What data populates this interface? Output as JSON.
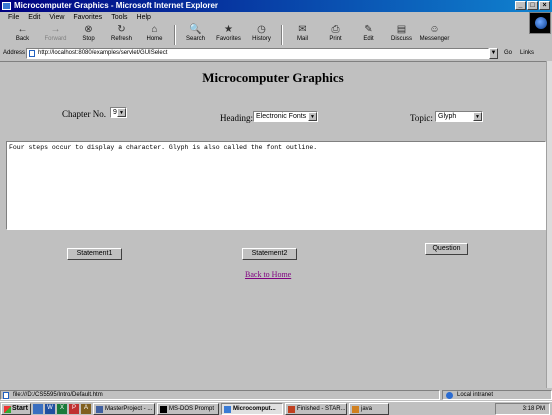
{
  "window": {
    "title": "Microcomputer Graphics - Microsoft Internet Explorer"
  },
  "menu": [
    "File",
    "Edit",
    "View",
    "Favorites",
    "Tools",
    "Help"
  ],
  "toolbar": [
    {
      "label": "Back",
      "icon": "←"
    },
    {
      "label": "Forward",
      "icon": "→"
    },
    {
      "label": "Stop",
      "icon": "⊗"
    },
    {
      "label": "Refresh",
      "icon": "↻"
    },
    {
      "label": "Home",
      "icon": "⌂"
    },
    {
      "label": "Search",
      "icon": "🔍"
    },
    {
      "label": "Favorites",
      "icon": "★"
    },
    {
      "label": "History",
      "icon": "◷"
    },
    {
      "label": "Mail",
      "icon": "✉"
    },
    {
      "label": "Print",
      "icon": "⎙"
    },
    {
      "label": "Edit",
      "icon": "✎"
    },
    {
      "label": "Discuss",
      "icon": "▤"
    },
    {
      "label": "Messenger",
      "icon": "☺"
    }
  ],
  "address": {
    "label": "Address",
    "url": "http://localhost:8080/examples/servlet/GUISelect",
    "go": "Go",
    "links": "Links"
  },
  "page": {
    "title": "Microcomputer Graphics",
    "chapter_label": "Chapter No.",
    "chapter_value": "9",
    "heading_label": "Heading:",
    "heading_value": "Electronic Fonts",
    "topic_label": "Topic:",
    "topic_value": "Glyph",
    "statement_text": "Four steps occur to display a character. Glyph is also called the font outline.",
    "buttons": {
      "statement1": "Statement1",
      "statement2": "Statement2",
      "question": "Question"
    },
    "back_link": "Back to Home"
  },
  "status": {
    "text": "file:///D:/CS5595/Intro/Default.htm",
    "zone": "Local intranet"
  },
  "taskbar": {
    "start": "Start",
    "tasks": [
      "MasterProject - ...",
      "MS-DOS Prompt",
      "Microcomput...",
      "Finished - STAR...",
      "java"
    ],
    "clock": "3:18 PM"
  },
  "colors": {
    "titlebar": "#000080",
    "link_visited": "#800080",
    "face": "#c0c0c0"
  }
}
